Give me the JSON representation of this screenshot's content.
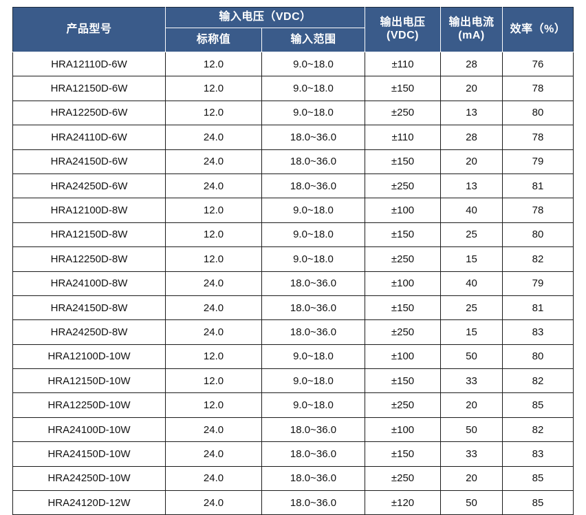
{
  "table": {
    "accent_color": "#3a5b8a",
    "border_color": "#1a1a1a",
    "header": {
      "col_model": "产品型号",
      "group_input_voltage": "输入电压（VDC）",
      "col_nominal": "标称值",
      "col_input_range": "输入范围",
      "col_output_voltage_l1": "输出电压",
      "col_output_voltage_l2": "(VDC)",
      "col_output_current_l1": "输出电流",
      "col_output_current_l2": "(mA)",
      "col_efficiency": "效率（%）"
    },
    "columns": [
      "产品型号",
      "标称值",
      "输入范围",
      "输出电压(VDC)",
      "输出电流(mA)",
      "效率(%)"
    ],
    "rows": [
      {
        "model": "HRA12110D-6W",
        "nominal": "12.0",
        "range": "9.0~18.0",
        "vout": "±110",
        "iout": "28",
        "eff": "76"
      },
      {
        "model": "HRA12150D-6W",
        "nominal": "12.0",
        "range": "9.0~18.0",
        "vout": "±150",
        "iout": "20",
        "eff": "78"
      },
      {
        "model": "HRA12250D-6W",
        "nominal": "12.0",
        "range": "9.0~18.0",
        "vout": "±250",
        "iout": "13",
        "eff": "80"
      },
      {
        "model": "HRA24110D-6W",
        "nominal": "24.0",
        "range": "18.0~36.0",
        "vout": "±110",
        "iout": "28",
        "eff": "78"
      },
      {
        "model": "HRA24150D-6W",
        "nominal": "24.0",
        "range": "18.0~36.0",
        "vout": "±150",
        "iout": "20",
        "eff": "79"
      },
      {
        "model": "HRA24250D-6W",
        "nominal": "24.0",
        "range": "18.0~36.0",
        "vout": "±250",
        "iout": "13",
        "eff": "81"
      },
      {
        "model": "HRA12100D-8W",
        "nominal": "12.0",
        "range": "9.0~18.0",
        "vout": "±100",
        "iout": "40",
        "eff": "78"
      },
      {
        "model": "HRA12150D-8W",
        "nominal": "12.0",
        "range": "9.0~18.0",
        "vout": "±150",
        "iout": "25",
        "eff": "80"
      },
      {
        "model": "HRA12250D-8W",
        "nominal": "12.0",
        "range": "9.0~18.0",
        "vout": "±250",
        "iout": "15",
        "eff": "82"
      },
      {
        "model": "HRA24100D-8W",
        "nominal": "24.0",
        "range": "18.0~36.0",
        "vout": "±100",
        "iout": "40",
        "eff": "79"
      },
      {
        "model": "HRA24150D-8W",
        "nominal": "24.0",
        "range": "18.0~36.0",
        "vout": "±150",
        "iout": "25",
        "eff": "81"
      },
      {
        "model": "HRA24250D-8W",
        "nominal": "24.0",
        "range": "18.0~36.0",
        "vout": "±250",
        "iout": "15",
        "eff": "83"
      },
      {
        "model": "HRA12100D-10W",
        "nominal": "12.0",
        "range": "9.0~18.0",
        "vout": "±100",
        "iout": "50",
        "eff": "80"
      },
      {
        "model": "HRA12150D-10W",
        "nominal": "12.0",
        "range": "9.0~18.0",
        "vout": "±150",
        "iout": "33",
        "eff": "82"
      },
      {
        "model": "HRA12250D-10W",
        "nominal": "12.0",
        "range": "9.0~18.0",
        "vout": "±250",
        "iout": "20",
        "eff": "85"
      },
      {
        "model": "HRA24100D-10W",
        "nominal": "24.0",
        "range": "18.0~36.0",
        "vout": "±100",
        "iout": "50",
        "eff": "82"
      },
      {
        "model": "HRA24150D-10W",
        "nominal": "24.0",
        "range": "18.0~36.0",
        "vout": "±150",
        "iout": "33",
        "eff": "83"
      },
      {
        "model": "HRA24250D-10W",
        "nominal": "24.0",
        "range": "18.0~36.0",
        "vout": "±250",
        "iout": "20",
        "eff": "85"
      },
      {
        "model": "HRA24120D-12W",
        "nominal": "24.0",
        "range": "18.0~36.0",
        "vout": "±120",
        "iout": "50",
        "eff": "85"
      }
    ]
  }
}
